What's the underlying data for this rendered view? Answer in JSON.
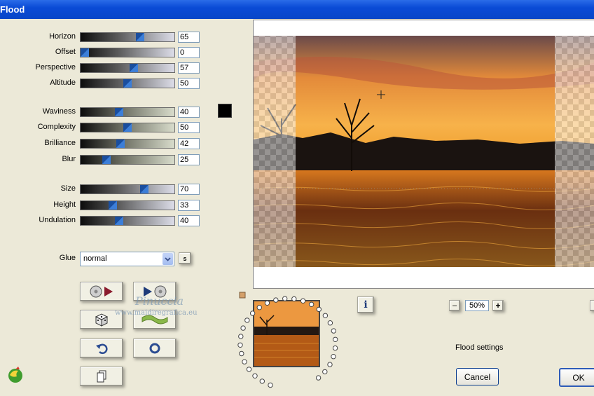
{
  "window": {
    "title": "Flood"
  },
  "sliders": [
    {
      "label": "Horizon",
      "value": "65",
      "fraction": 0.65,
      "track": "dark"
    },
    {
      "label": "Offset",
      "value": "0",
      "fraction": 0.0,
      "track": "dark"
    },
    {
      "label": "Perspective",
      "value": "57",
      "fraction": 0.57,
      "track": "dark"
    },
    {
      "label": "Altitude",
      "value": "50",
      "fraction": 0.5,
      "track": "dark"
    },
    {
      "label": "Waviness",
      "value": "40",
      "fraction": 0.4,
      "track": "olive"
    },
    {
      "label": "Complexity",
      "value": "50",
      "fraction": 0.5,
      "track": "olive"
    },
    {
      "label": "Brilliance",
      "value": "42",
      "fraction": 0.42,
      "track": "olive"
    },
    {
      "label": "Blur",
      "value": "25",
      "fraction": 0.25,
      "track": "olive"
    },
    {
      "label": "Size",
      "value": "70",
      "fraction": 0.7,
      "track": "dark"
    },
    {
      "label": "Height",
      "value": "33",
      "fraction": 0.33,
      "track": "dark"
    },
    {
      "label": "Undulation",
      "value": "40",
      "fraction": 0.4,
      "track": "dark"
    }
  ],
  "color_swatch": "#000000",
  "glue": {
    "label": "Glue",
    "value": "normal",
    "side_button": "s"
  },
  "watermark": {
    "line1": "Pinuccia",
    "line2": "www.maidiregrafica.eu"
  },
  "zoom": {
    "minus": "–",
    "value": "50%",
    "plus": "+"
  },
  "info_icon": "i",
  "status": "Flood settings",
  "buttons": {
    "cancel": "Cancel",
    "ok": "OK"
  },
  "colors": {
    "title_bar": "#0a4bd6",
    "dialog_bg": "#ece9d8",
    "accent": "#1a4e9e"
  }
}
